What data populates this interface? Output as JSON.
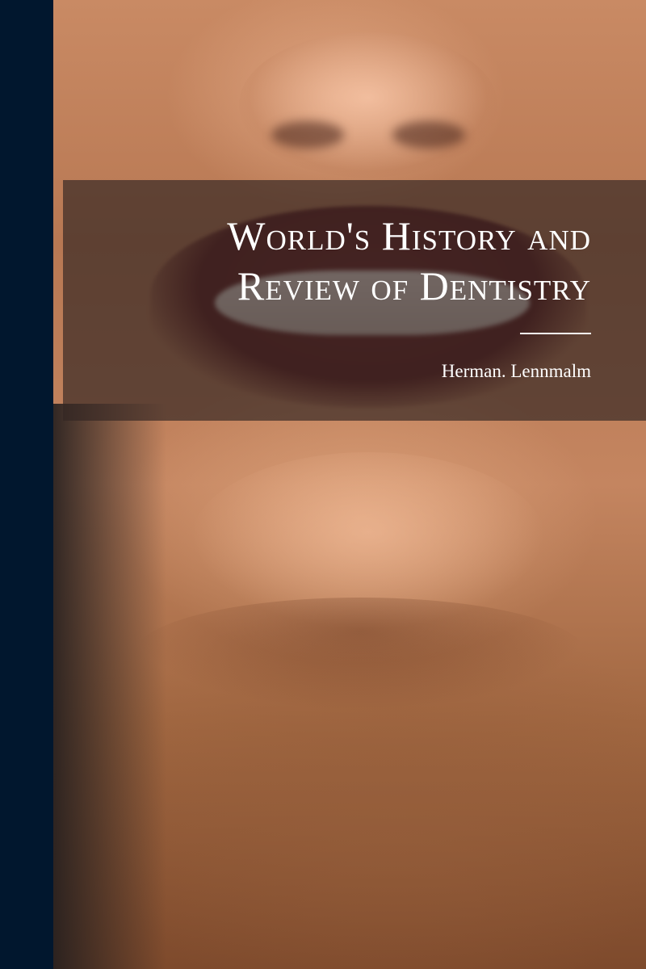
{
  "book": {
    "title_line1": "World's History and",
    "title_line2": "Review of Dentistry",
    "author": "Herman. Lennmalm"
  },
  "colors": {
    "spine": "#01172e",
    "band": "#342624",
    "text": "#ffffff"
  }
}
